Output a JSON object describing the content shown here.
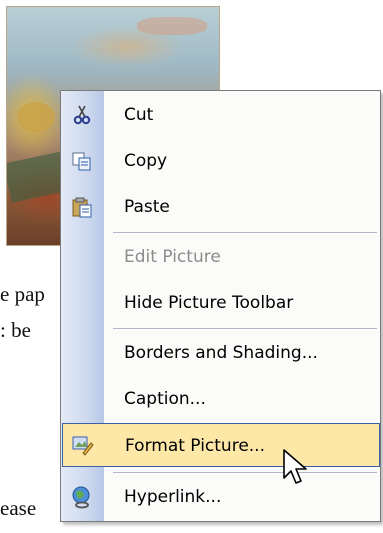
{
  "document": {
    "lines": [
      "e pap",
      ": be",
      "ease"
    ]
  },
  "menu": {
    "items": [
      {
        "label": "Cut",
        "icon": "scissors-icon",
        "enabled": true
      },
      {
        "label": "Copy",
        "icon": "copy-icon",
        "enabled": true
      },
      {
        "label": "Paste",
        "icon": "paste-icon",
        "enabled": true
      },
      {
        "label": "Edit Picture",
        "icon": "",
        "enabled": false
      },
      {
        "label": "Hide Picture Toolbar",
        "icon": "",
        "enabled": true
      },
      {
        "label": "Borders and Shading...",
        "icon": "",
        "enabled": true
      },
      {
        "label": "Caption...",
        "icon": "",
        "enabled": true
      },
      {
        "label": "Format Picture...",
        "icon": "format-picture-icon",
        "enabled": true,
        "highlighted": true
      },
      {
        "label": "Hyperlink...",
        "icon": "hyperlink-globe-icon",
        "enabled": true
      }
    ]
  },
  "colors": {
    "highlight_bg": "#fde8a8",
    "highlight_border": "#3a5ea8",
    "strip": "#cdd9ee"
  }
}
